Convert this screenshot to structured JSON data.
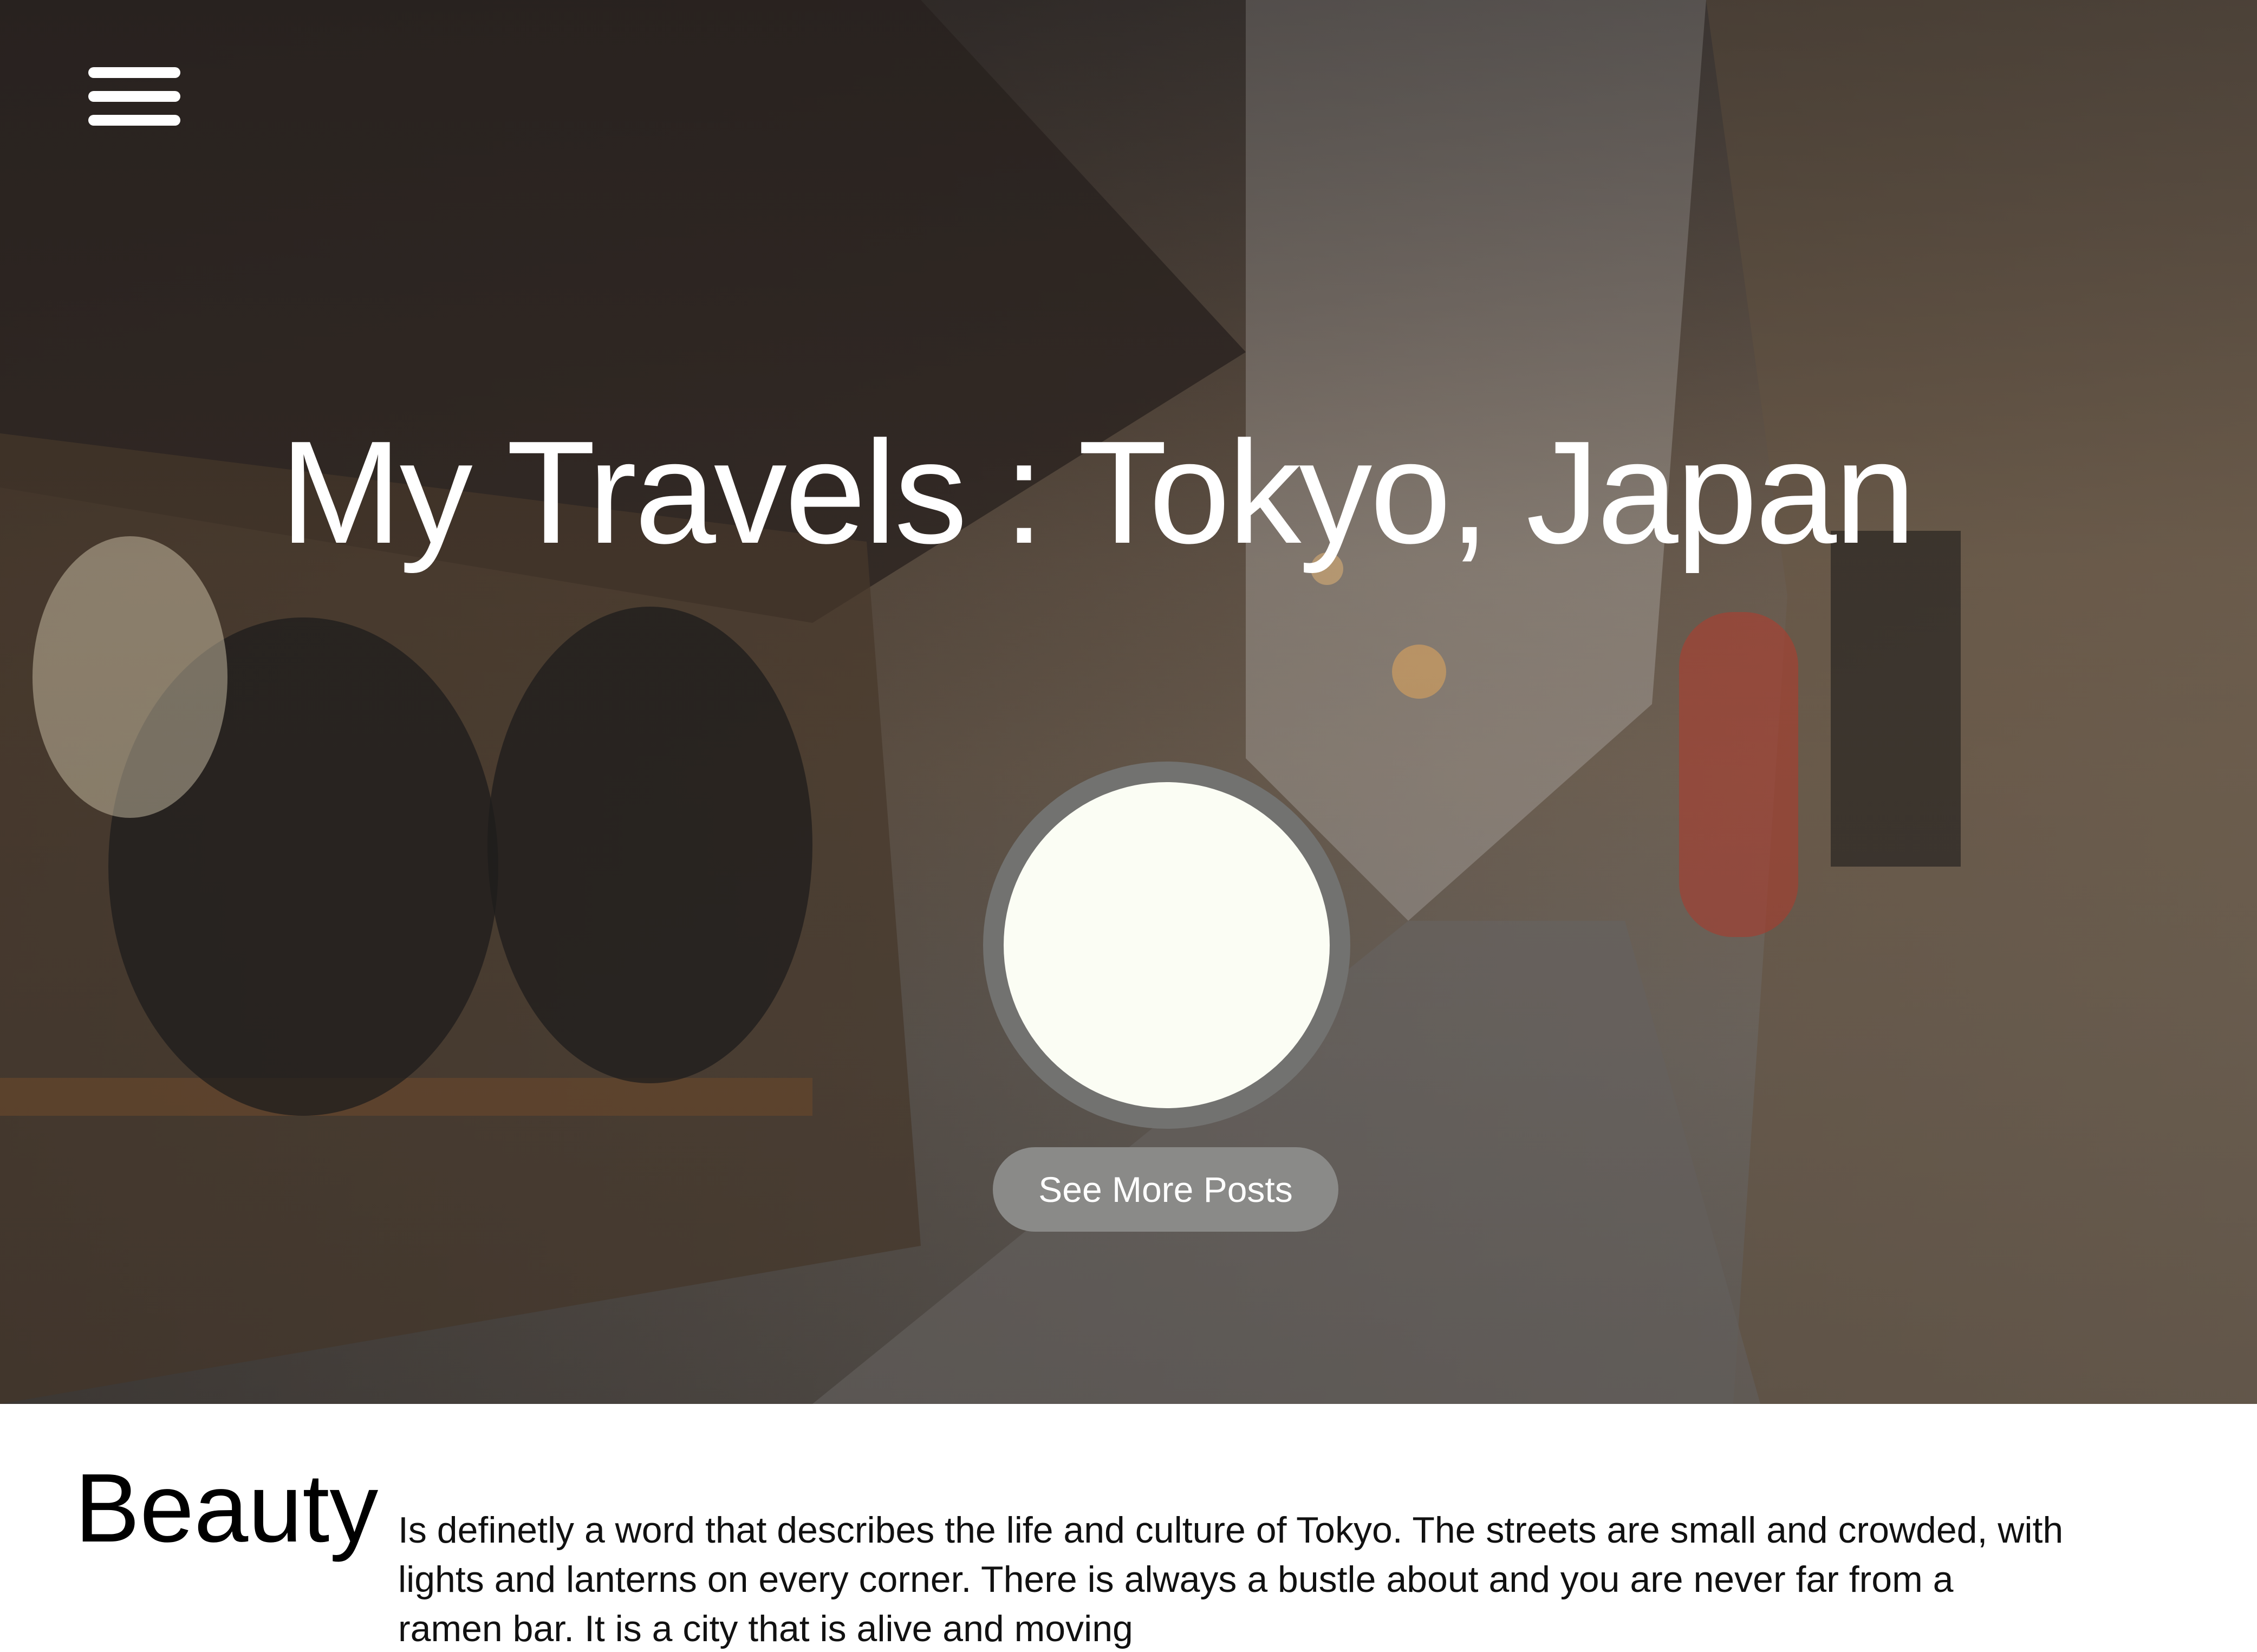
{
  "hero": {
    "title": "My Travels : Tokyo, Japan",
    "see_more_label": "See More Posts"
  },
  "menu": {
    "icon": "hamburger-menu-icon"
  },
  "intro": {
    "heading": "Beauty",
    "body": "Is definetly a word that describes the life and culture of Tokyo. The streets are small and crowded, with lights and lanterns on every corner. There is always a bustle about and you are never far from a ramen bar. It is a city that is alive and moving"
  },
  "colors": {
    "avatar_fill": "#fbfdf4",
    "avatar_ring": "#727270",
    "button_fill": "#8a8a88",
    "text_on_hero": "#ffffff"
  }
}
